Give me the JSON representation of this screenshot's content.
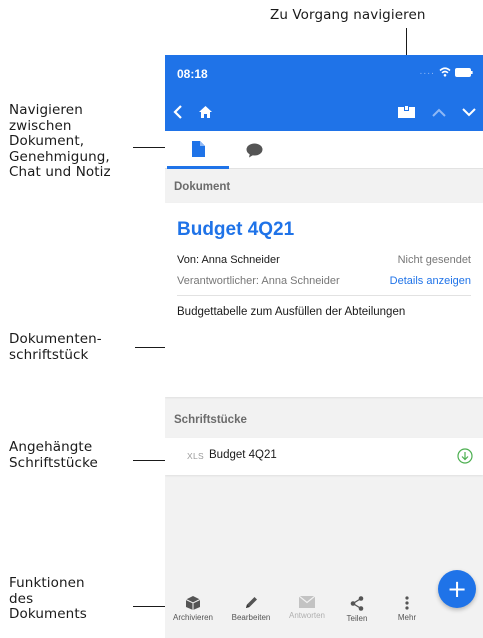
{
  "annotations": {
    "top": "Zu Vorgang navigieren",
    "nav_lines": [
      "Navigieren",
      "zwischen",
      "Dokument,",
      "Genehmigung,",
      "Chat und Notiz"
    ],
    "doc_lines": [
      "Dokumenten-",
      "schriftstück"
    ],
    "attach_lines": [
      "Angehängte",
      "Schriftstücke"
    ],
    "func_lines": [
      "Funktionen",
      "des",
      "Dokuments"
    ]
  },
  "status_bar": {
    "time": "08:18",
    "signal": "...."
  },
  "colors": {
    "accent": "#1f73e8",
    "green": "#4caf50",
    "background": "#f2f2f2"
  },
  "icons": {
    "nav": [
      "back-icon",
      "home-icon",
      "case-icon",
      "chevron-up-icon",
      "chevron-down-icon"
    ],
    "tabs": [
      "document-icon",
      "chat-icon"
    ]
  },
  "document": {
    "section_label": "Dokument",
    "title": "Budget 4Q21",
    "from": "Von: Anna Schneider",
    "status": "Nicht gesendet",
    "responsible": "Verantwortlicher: Anna Schneider",
    "details_link": "Details anzeigen",
    "description": "Budgettabelle zum Ausfüllen der Abteilungen"
  },
  "attachments": {
    "section_label": "Schriftstücke",
    "items": [
      {
        "type": "XLS",
        "name": "Budget 4Q21"
      }
    ]
  },
  "bottom_bar": {
    "items": [
      {
        "label": "Archivieren",
        "icon": "archive-icon",
        "enabled": true
      },
      {
        "label": "Bearbeiten",
        "icon": "pencil-icon",
        "enabled": true
      },
      {
        "label": "Antworten",
        "icon": "mail-icon",
        "enabled": false
      },
      {
        "label": "Teilen",
        "icon": "share-icon",
        "enabled": true
      },
      {
        "label": "Mehr",
        "icon": "more-icon",
        "enabled": true
      }
    ]
  },
  "fab": {
    "symbol": "+",
    "icon": "plus-icon"
  }
}
